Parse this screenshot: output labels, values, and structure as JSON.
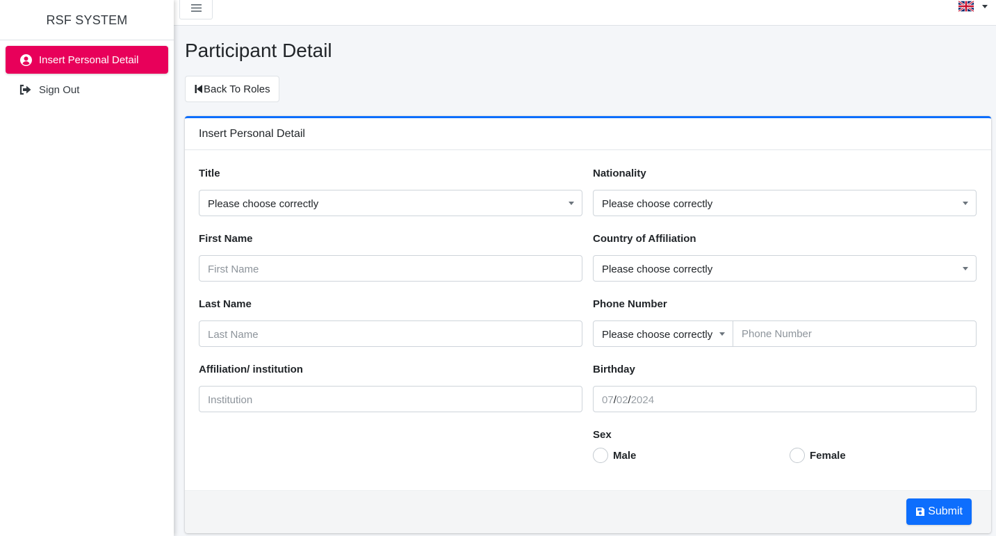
{
  "brand": {
    "title": "RSF SYSTEM"
  },
  "sidebar": {
    "items": [
      {
        "label": "Insert Personal Detail",
        "icon": "user-circle-icon",
        "active": true
      },
      {
        "label": "Sign Out",
        "icon": "sign-out-icon",
        "active": false
      }
    ]
  },
  "topbar": {
    "menu_icon": "hamburger-icon",
    "language_icon": "uk-flag-icon"
  },
  "page": {
    "title": "Participant Detail",
    "back_button": "Back To Roles"
  },
  "form": {
    "header": "Insert Personal Detail",
    "title": {
      "label": "Title",
      "value": "Please choose correctly"
    },
    "first_name": {
      "label": "First Name",
      "placeholder": "First Name"
    },
    "last_name": {
      "label": "Last Name",
      "placeholder": "Last Name"
    },
    "institution": {
      "label": "Affiliation/ institution",
      "placeholder": "Institution"
    },
    "nationality": {
      "label": "Nationality",
      "value": "Please choose correctly"
    },
    "country": {
      "label": "Country of Affiliation",
      "value": "Please choose correctly"
    },
    "phone": {
      "label": "Phone Number",
      "code_value": "Please choose correctly",
      "placeholder": "Phone Number"
    },
    "birthday": {
      "label": "Birthday",
      "month": "07",
      "day": "02",
      "year": "2024",
      "sep": "/"
    },
    "sex": {
      "label": "Sex",
      "options": [
        "Male",
        "Female"
      ]
    },
    "submit": "Submit"
  },
  "colors": {
    "accent": "#e8005a",
    "primary": "#0d6efd"
  }
}
